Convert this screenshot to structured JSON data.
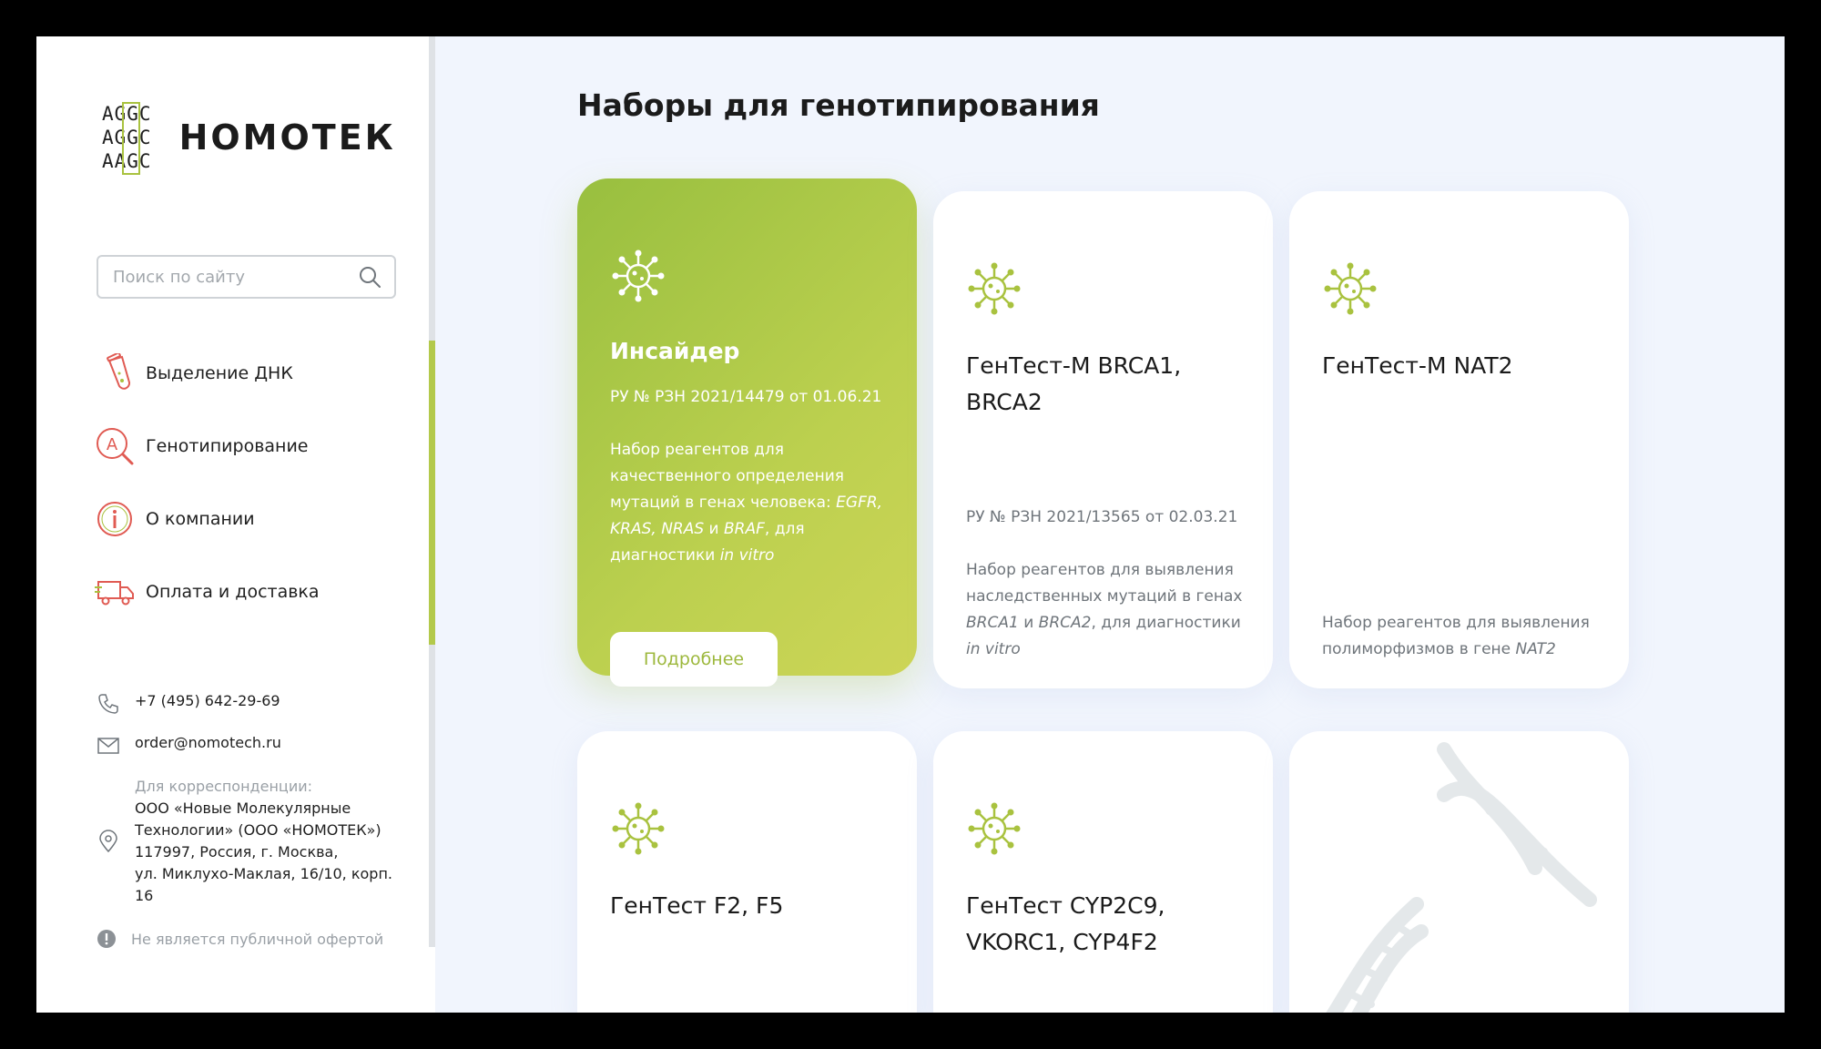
{
  "brand": {
    "logo_rows": [
      "AGGC",
      "AGGC",
      "AAGC"
    ],
    "name": "НОМОТЕК"
  },
  "search": {
    "placeholder": "Поиск по сайту",
    "value": ""
  },
  "nav": [
    {
      "label": "Выделение ДНК",
      "icon": "test-tube-icon"
    },
    {
      "label": "Генотипирование",
      "icon": "magnifier-letter-icon"
    },
    {
      "label": "О компании",
      "icon": "info-icon"
    },
    {
      "label": "Оплата и доставка",
      "icon": "delivery-truck-icon"
    }
  ],
  "contacts": {
    "phone": "+7 (495) 642-29-69",
    "email": "order@nomotech.ru",
    "address_label": "Для корреспонденции:",
    "address_lines": [
      "ООО «Новые Молекулярные",
      "Технологии» (ООО «НОМОТЕК»)",
      "117997, Россия, г. Москва,",
      "ул. Миклухо-Маклая, 16/10, корп. 16"
    ],
    "disclaimer": "Не является публичной офертой"
  },
  "page": {
    "title": "Наборы для генотипирования"
  },
  "cards": [
    {
      "title": "Инсайдер",
      "reg": "РУ № РЗН 2021/14479 от 01.06.21",
      "desc_parts": [
        {
          "t": "Набор реагентов для качественного определения мутаций в генах человека: ",
          "i": false
        },
        {
          "t": "EGFR, KRAS, NRAS",
          "i": true
        },
        {
          "t": " и ",
          "i": false
        },
        {
          "t": "BRAF",
          "i": true
        },
        {
          "t": ", для диагностики ",
          "i": false
        },
        {
          "t": "in vitro",
          "i": true
        }
      ],
      "button": "Подробнее"
    },
    {
      "title": "ГенТест-М BRCA1, BRCA2",
      "reg": "РУ № РЗН 2021/13565 от 02.03.21",
      "desc_parts": [
        {
          "t": "Набор реагентов для выявления наследственных мутаций в генах ",
          "i": false
        },
        {
          "t": "BRCA1",
          "i": true
        },
        {
          "t": " и ",
          "i": false
        },
        {
          "t": "BRCA2",
          "i": true
        },
        {
          "t": ", для диагностики ",
          "i": false
        },
        {
          "t": "in vitro",
          "i": true
        }
      ]
    },
    {
      "title": "ГенТест-М NAT2",
      "desc_parts": [
        {
          "t": "Набор реагентов для выявления полиморфизмов в гене ",
          "i": false
        },
        {
          "t": "NAT2",
          "i": true
        }
      ]
    },
    {
      "title": "ГенТест F2, F5"
    },
    {
      "title": "ГенТест CYP2C9, VKORC1, CYP4F2"
    }
  ],
  "colors": {
    "accent_green": "#a9c23f",
    "accent_red": "#e05b53",
    "background": "#f1f5fd"
  }
}
